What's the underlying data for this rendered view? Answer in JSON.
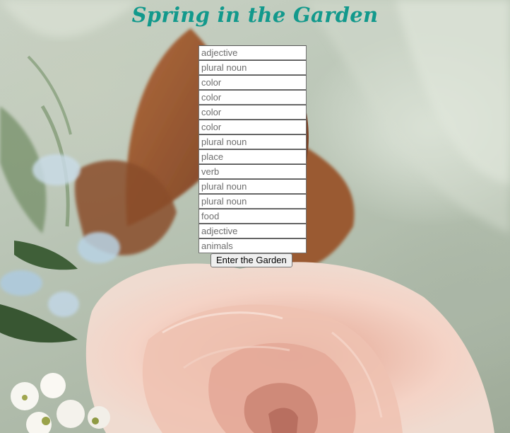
{
  "page": {
    "title": "Spring in the Garden",
    "title_color": "#12998c"
  },
  "form": {
    "fields": [
      {
        "placeholder": "adjective",
        "value": ""
      },
      {
        "placeholder": "plural noun",
        "value": ""
      },
      {
        "placeholder": "color",
        "value": ""
      },
      {
        "placeholder": "color",
        "value": ""
      },
      {
        "placeholder": "color",
        "value": ""
      },
      {
        "placeholder": "color",
        "value": ""
      },
      {
        "placeholder": "plural noun",
        "value": ""
      },
      {
        "placeholder": "place",
        "value": ""
      },
      {
        "placeholder": "verb",
        "value": ""
      },
      {
        "placeholder": "plural noun",
        "value": ""
      },
      {
        "placeholder": "plural noun",
        "value": ""
      },
      {
        "placeholder": "food",
        "value": ""
      },
      {
        "placeholder": "adjective",
        "value": ""
      },
      {
        "placeholder": "animals",
        "value": ""
      }
    ],
    "submit_label": "Enter the Garden"
  },
  "background": {
    "image": "flower-bouquet-photo",
    "colors": {
      "sage": "#b9c4b7",
      "rose": "#f2cfc2",
      "rose_center": "#d99a8a",
      "leaf_brown": "#9a5a32",
      "blue_flower": "#b5d1e3"
    }
  }
}
